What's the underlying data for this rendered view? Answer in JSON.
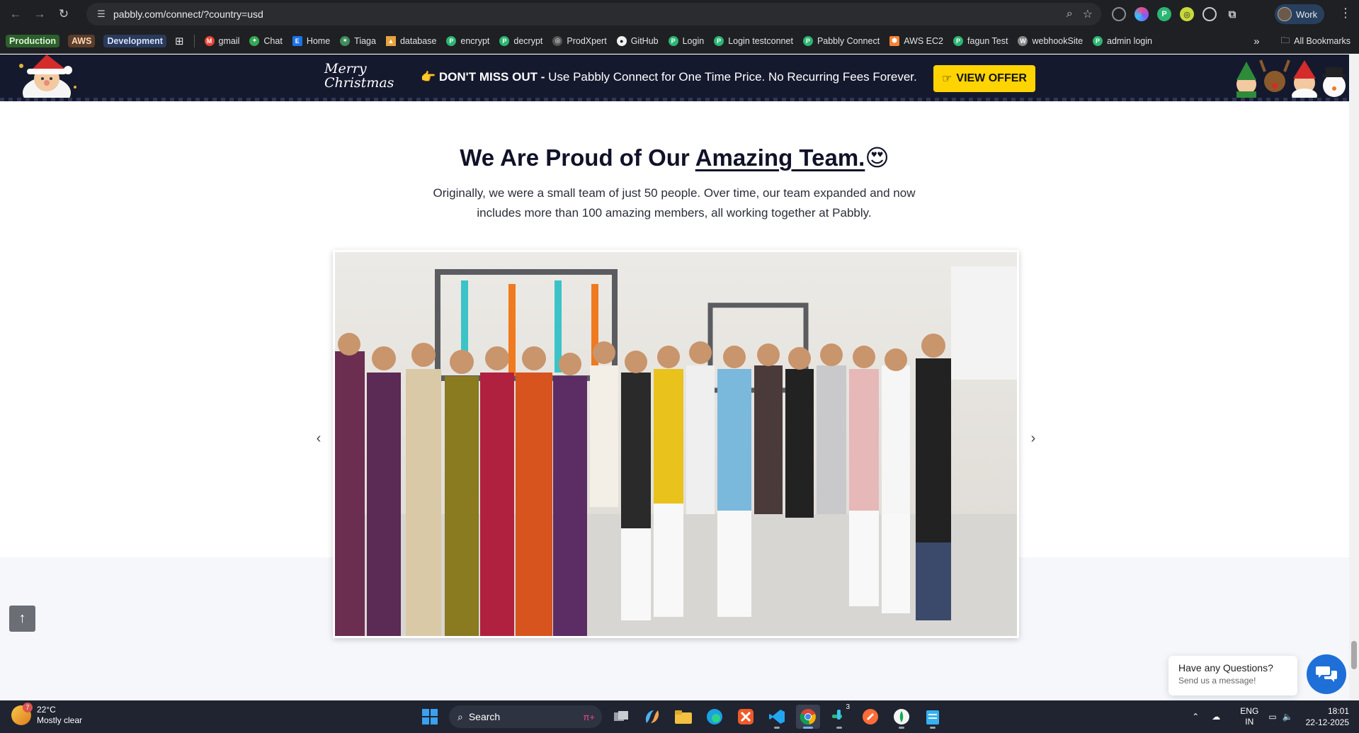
{
  "browser": {
    "url": "pabbly.com/connect/?country=usd",
    "profile_label": "Work"
  },
  "bookmarks": {
    "chips": [
      "Production",
      "AWS",
      "Development"
    ],
    "items": [
      "gmail",
      "Chat",
      "Home",
      "Tiaga",
      "database",
      "encrypt",
      "decrypt",
      "ProdXpert",
      "GitHub",
      "Login",
      "Login testconnet",
      "Pabbly Connect",
      "AWS EC2",
      "fagun Test",
      "webhookSite",
      "admin login"
    ],
    "all_bookmarks": "All Bookmarks"
  },
  "banner": {
    "xmas_line1": "Merry",
    "xmas_line2": "Christmas",
    "strong": "DON'T MISS OUT -",
    "message": "Use Pabbly Connect for One Time Price. No Recurring Fees Forever.",
    "button": "VIEW OFFER",
    "accent": "#ffd400",
    "background": "#15192e"
  },
  "section": {
    "title_pre": "We Are Proud of Our ",
    "title_underlined": "Amazing Team.",
    "title_emoji": "😍",
    "subtitle": "Originally, we were a small team of just 50 people. Over time, our team expanded and now includes more than 100 amazing members, all working together at Pabbly."
  },
  "chat": {
    "question": "Have any Questions?",
    "prompt": "Send us a message!",
    "color": "#1f6fd8"
  },
  "taskbar": {
    "temperature": "22°C",
    "weather": "Mostly clear",
    "weather_badge": "7",
    "search": "Search",
    "lang1": "ENG",
    "lang2": "IN",
    "time": "18:01",
    "date": "22-12-2025",
    "badge_count": "3"
  }
}
